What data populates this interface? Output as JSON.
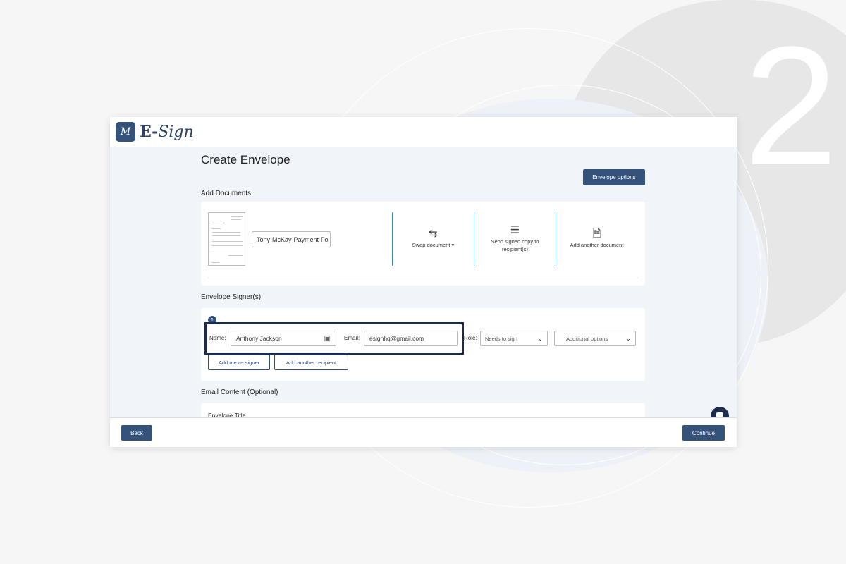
{
  "background": {
    "step_number": "2"
  },
  "header": {
    "logo_mark": "M",
    "logo_text_e": "E-",
    "logo_text_sign": "Sign"
  },
  "page": {
    "title": "Create Envelope",
    "envelope_options_label": "Envelope options"
  },
  "documents": {
    "section_label": "Add Documents",
    "document_name": "Tony-McKay-Payment-Fo",
    "swap_label": "Swap document ▾",
    "send_signed_copy_label": "Send signed copy to recipient(s)",
    "add_another_label": "Add another document"
  },
  "signers": {
    "section_label": "Envelope Signer(s)",
    "signer_index": "1",
    "name_label": "Name:",
    "name_value": "Anthony Jackson",
    "email_label": "Email:",
    "email_value": "esignhq@gmail.com",
    "role_label": "Role:",
    "role_value": "Needs to sign",
    "additional_options_value": "Additional options",
    "add_me_label": "Add me as signer",
    "add_recipient_label": "Add another recipient"
  },
  "email_content": {
    "section_label": "Email Content (Optional)",
    "envelope_title_label": "Envelope Title"
  },
  "footer": {
    "back_label": "Back",
    "continue_label": "Continue"
  },
  "colors": {
    "primary": "#34527a",
    "highlight": "#1d2b4d",
    "divider": "#3a8fd8"
  }
}
